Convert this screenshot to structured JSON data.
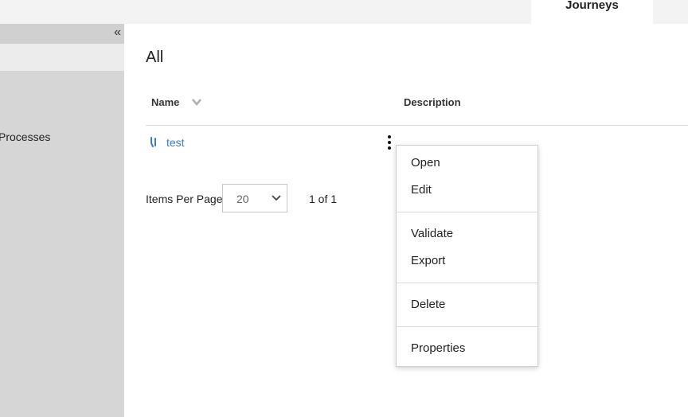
{
  "header": {
    "tab_label": "Journeys"
  },
  "sidebar": {
    "collapse_glyph": "«",
    "items": [
      {
        "label": "Processes"
      }
    ]
  },
  "main": {
    "title": "All",
    "table": {
      "columns": [
        "Name",
        "Description"
      ],
      "rows": [
        {
          "name": "test",
          "description": ""
        }
      ]
    },
    "pagination": {
      "items_per_page_label": "Items Per Page",
      "items_per_page_value": "20",
      "page_count": "1 of 1"
    }
  },
  "context_menu": {
    "items": [
      "Open",
      "Edit",
      "Validate",
      "Export",
      "Delete",
      "Properties"
    ]
  },
  "colors": {
    "link": "#3d7ab8",
    "sidebar_bg": "#d6d6d6",
    "topbar_bg": "#f3f3f3"
  },
  "icons": [
    "collapse-sidebar-icon",
    "sort-chevron-icon",
    "journey-icon",
    "kebab-menu-icon",
    "chevron-down-icon"
  ]
}
